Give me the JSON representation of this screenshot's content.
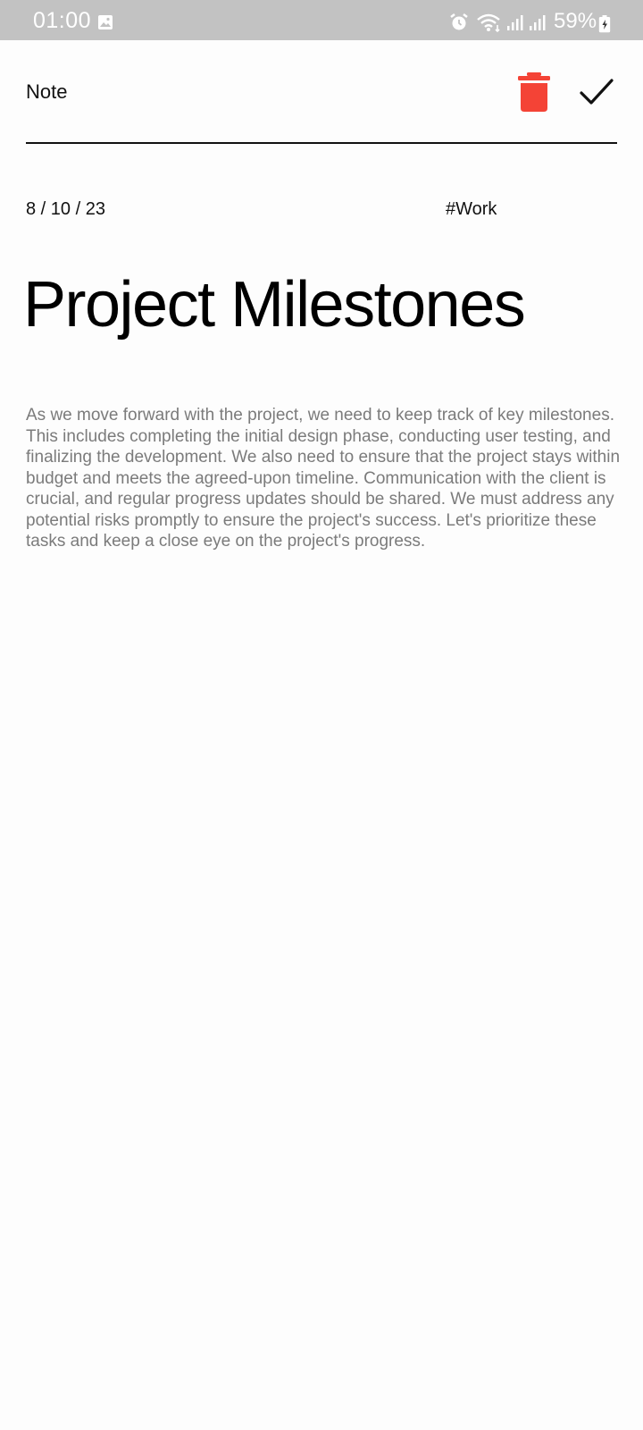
{
  "status_bar": {
    "time": "01:00",
    "battery": "59%",
    "icons": [
      "gallery-icon",
      "alarm-icon",
      "wifi-icon",
      "signal-icon",
      "signal-icon",
      "battery-icon"
    ]
  },
  "header": {
    "title": "Note",
    "delete_icon": "trash-icon",
    "confirm_icon": "checkmark-icon",
    "delete_color": "#f44336"
  },
  "note": {
    "date": "8 / 10 / 23",
    "tag": "#Work",
    "title": "Project Milestones",
    "body": "As we move forward with the project, we need to keep track of key milestones. This includes completing the initial design phase, conducting user testing, and finalizing the development. We also need to ensure that the project stays within budget and meets the agreed-upon timeline. Communication with the client is crucial, and regular progress updates should be shared. We must address any potential risks promptly to ensure the project's success. Let's prioritize these tasks and keep a close eye on the project's progress."
  }
}
